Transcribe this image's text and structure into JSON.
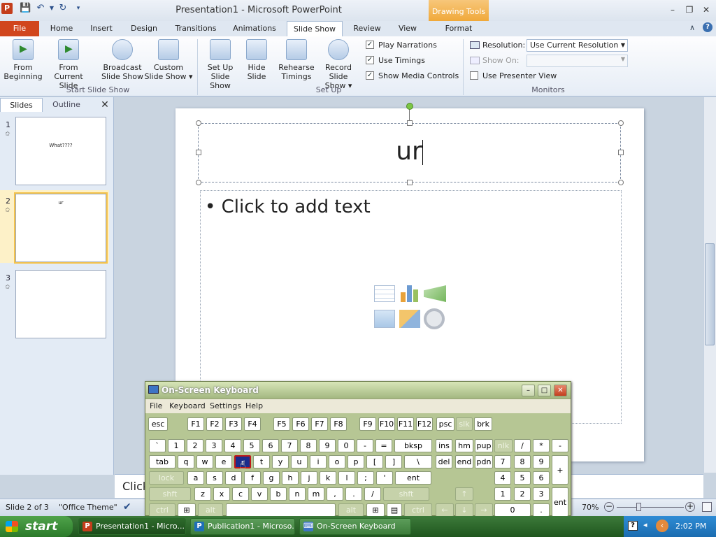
{
  "app": {
    "window_title": "Presentation1  -  Microsoft PowerPoint",
    "icon_letter": "P",
    "context_tab_group": "Drawing Tools"
  },
  "qat": [
    "save-icon",
    "undo-icon",
    "dropdown-icon",
    "redo-icon",
    "customize-icon"
  ],
  "window_controls": {
    "minimize": "–",
    "restore": "❐",
    "close": "✕"
  },
  "tabs": [
    "File",
    "Home",
    "Insert",
    "Design",
    "Transitions",
    "Animations",
    "Slide Show",
    "Review",
    "View",
    "Format"
  ],
  "active_tab": "Slide Show",
  "ribbon": {
    "start_slide_show": {
      "label": "Start Slide Show",
      "from_beginning": "From\nBeginning",
      "from_current": "From\nCurrent Slide",
      "broadcast": "Broadcast\nSlide Show",
      "custom": "Custom\nSlide Show ▾"
    },
    "set_up": {
      "label": "Set Up",
      "set_up_show": "Set Up\nSlide Show",
      "hide_slide": "Hide\nSlide",
      "rehearse": "Rehearse\nTimings",
      "record": "Record Slide\nShow ▾",
      "play_narrations": "Play Narrations",
      "use_timings": "Use Timings",
      "show_media": "Show Media Controls"
    },
    "monitors": {
      "label": "Monitors",
      "resolution_label": "Resolution:",
      "resolution_value": "Use Current Resolution",
      "show_on_label": "Show On:",
      "presenter_view": "Use Presenter View"
    }
  },
  "panel": {
    "tab_slides": "Slides",
    "tab_outline": "Outline",
    "close": "✕",
    "slides": [
      {
        "num": "1",
        "text": "What????"
      },
      {
        "num": "2",
        "text": "ur"
      },
      {
        "num": "3",
        "text": ""
      }
    ],
    "selected": 2
  },
  "slide": {
    "title": "ur",
    "content_placeholder": "Click to add text",
    "bullet": "•"
  },
  "notes": {
    "text": "Click"
  },
  "status": {
    "slide_info": "Slide 2 of 3",
    "theme": "\"Office Theme\"",
    "zoom": "70%"
  },
  "osk": {
    "title": "On-Screen Keyboard",
    "menus": [
      "File",
      "Keyboard",
      "Settings",
      "Help"
    ],
    "pressed_key": "r"
  },
  "taskbar": {
    "start": "start",
    "items": [
      {
        "label": "Presentation1 - Micro...",
        "icon": "P"
      },
      {
        "label": "Publication1 - Microso...",
        "icon": "P"
      },
      {
        "label": "On-Screen Keyboard",
        "icon": "⌨"
      }
    ],
    "time": "2:02 PM"
  },
  "colors": {
    "file_tab": "#d1461d",
    "drawing_tools": "#f0a93a",
    "taskbar": "#2b6b2a",
    "osk_bg": "#b6c694"
  }
}
